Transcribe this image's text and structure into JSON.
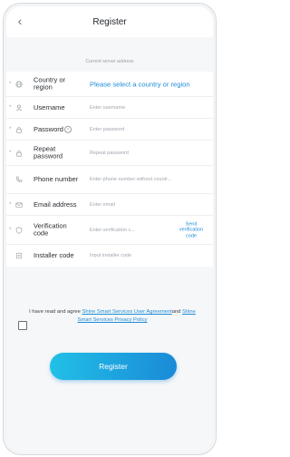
{
  "header": {
    "title": "Register",
    "back_icon": "chevron-left-icon"
  },
  "server_note": "Current server address",
  "fields": [
    {
      "key": "country",
      "label": "Country or region",
      "value": "Please select a country or region",
      "required": true,
      "icon": "globe-icon"
    },
    {
      "key": "username",
      "label": "Username",
      "placeholder": "Enter username",
      "required": true,
      "icon": "user-icon"
    },
    {
      "key": "password",
      "label": "Password",
      "placeholder": "Enter password",
      "required": true,
      "icon": "lock-icon",
      "help": "?"
    },
    {
      "key": "repeat_password",
      "label": "Repeat password",
      "placeholder": "Repeat password",
      "required": true,
      "icon": "lock-icon"
    },
    {
      "key": "phone",
      "label": "Phone number",
      "placeholder": "Enter phone number without countr...",
      "required": false,
      "icon": "phone-icon"
    },
    {
      "key": "email",
      "label": "Email address",
      "placeholder": "Enter email",
      "required": true,
      "icon": "mail-icon"
    },
    {
      "key": "verification",
      "label": "Verification code",
      "placeholder": "Enter verification c...",
      "required": true,
      "icon": "shield-icon",
      "action": "Send verification code"
    },
    {
      "key": "installer",
      "label": "Installer code",
      "placeholder": "Input installer code",
      "required": false,
      "icon": "id-icon"
    }
  ],
  "agreement": {
    "prefix": "I have read and agree ",
    "link1": "Shine Smart Services User Agreement",
    "mid": "and ",
    "link2": "Shine Smart Services Privacy Policy"
  },
  "register_button": "Register",
  "colors": {
    "accent": "#1b8cd6",
    "button_start": "#21c0e6",
    "button_end": "#1a8ad8"
  }
}
